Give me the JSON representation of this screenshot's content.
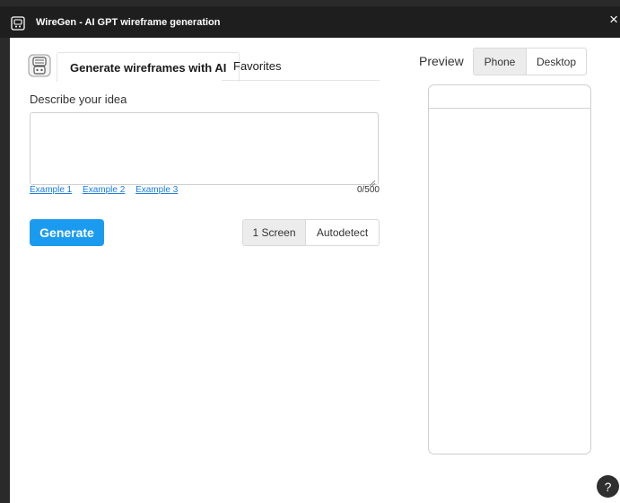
{
  "window": {
    "title": "WireGen - AI GPT wireframe generation",
    "close_symbol": "×"
  },
  "tabs": [
    {
      "label": "Generate wireframes with AI",
      "active": true
    },
    {
      "label": "Favorites",
      "active": false
    }
  ],
  "form": {
    "describe_label": "Describe your idea",
    "textarea_value": "",
    "examples": [
      "Example 1",
      "Example 2",
      "Example 3"
    ],
    "char_count": "0/500",
    "generate_label": "Generate"
  },
  "screen_mode": {
    "options": [
      "1 Screen",
      "Autodetect"
    ],
    "selected": "1 Screen"
  },
  "preview": {
    "label": "Preview",
    "options": [
      "Phone",
      "Desktop"
    ],
    "selected": "Phone"
  },
  "help": {
    "label": "?"
  },
  "colors": {
    "accent": "#1a9bf0",
    "link": "#1a7ce5",
    "titlebar": "#1e1e1e"
  },
  "icons": {
    "app": "wiregen-app-icon",
    "plugin": "robot-plugin-icon",
    "close": "close-icon",
    "help": "help-icon",
    "resize": "resize-grip-icon"
  }
}
